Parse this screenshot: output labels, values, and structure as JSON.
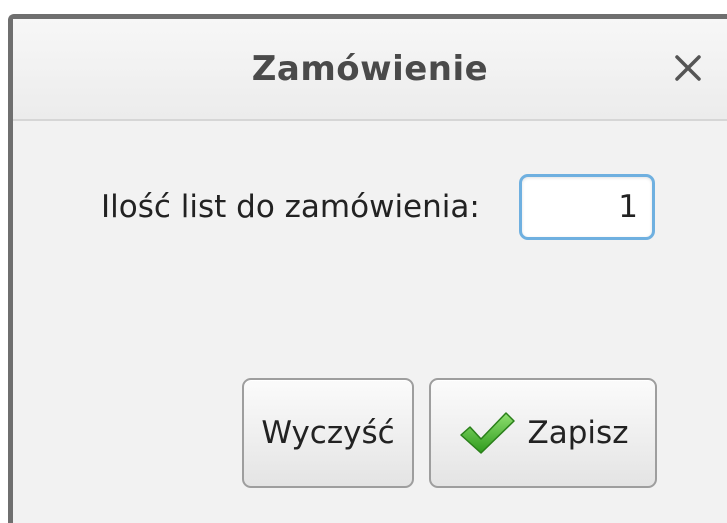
{
  "dialog": {
    "title": "Zamówienie",
    "close_icon": "close-icon"
  },
  "form": {
    "quantity_label": "Ilość list do zamówienia:",
    "quantity_value": "1"
  },
  "buttons": {
    "clear_label": "Wyczyść",
    "save_label": "Zapisz",
    "save_icon": "checkmark-icon"
  },
  "colors": {
    "input_focus_border": "#6fb0e0",
    "checkmark": "#3fae2a"
  }
}
